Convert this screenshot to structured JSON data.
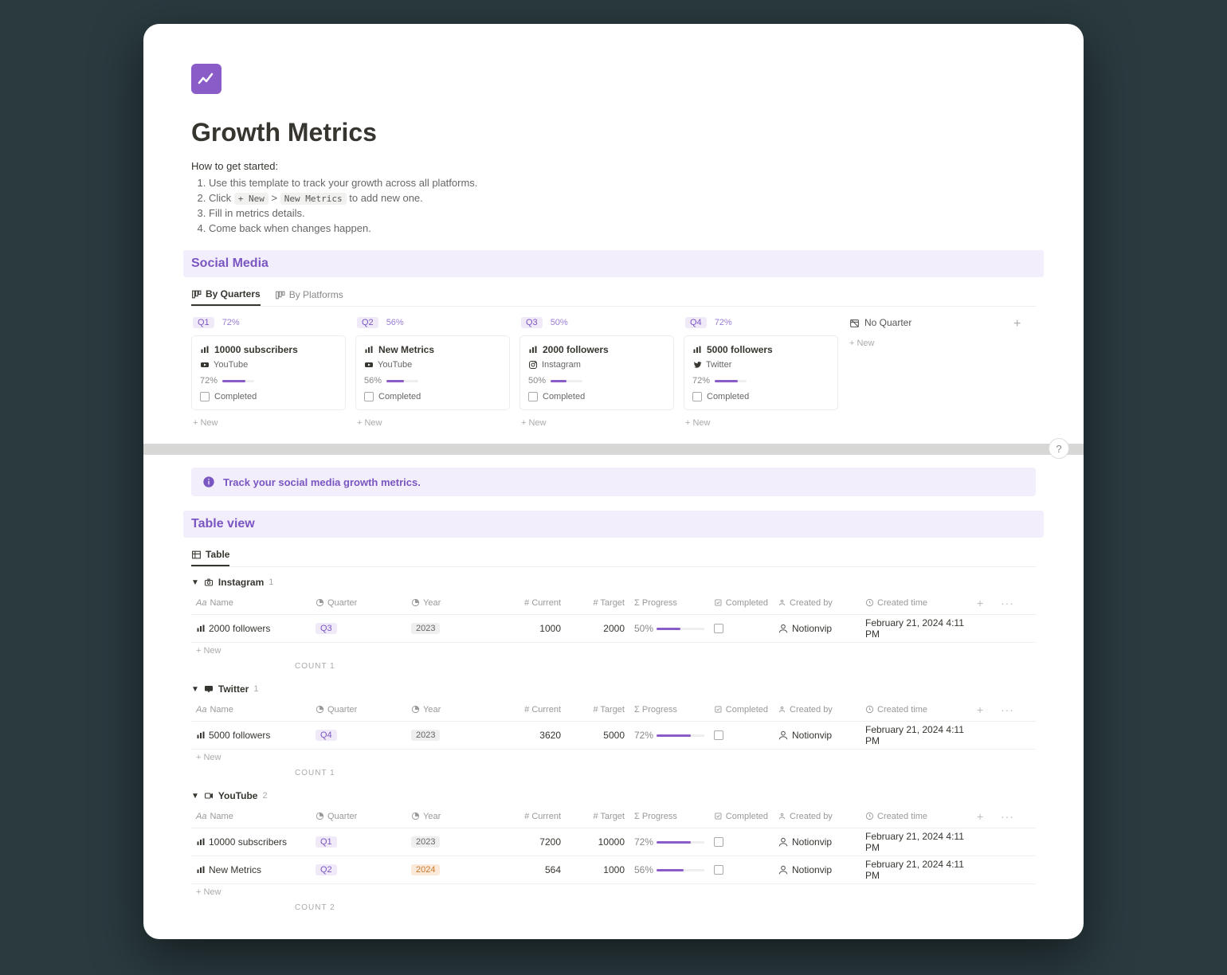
{
  "page": {
    "title": "Growth Metrics",
    "intro": "How to get started:",
    "steps": {
      "s1": "Use this template to track your growth across all platforms.",
      "s2_pre": "Click",
      "s2_chip1": "+ New",
      "s2_sep": ">",
      "s2_chip2": "New Metrics",
      "s2_post": "to add new one.",
      "s3": "Fill in metrics details.",
      "s4": "Come back when changes happen."
    }
  },
  "social": {
    "heading": "Social Media",
    "tabs": {
      "t1": "By Quarters",
      "t2": "By Platforms"
    },
    "cols": [
      {
        "q": "Q1",
        "pct": "72%",
        "card": {
          "title": "10000 subscribers",
          "platform": "YouTube",
          "prog": 72,
          "progLabel": "72%",
          "chk": "Completed"
        }
      },
      {
        "q": "Q2",
        "pct": "56%",
        "card": {
          "title": "New Metrics",
          "platform": "YouTube",
          "prog": 56,
          "progLabel": "56%",
          "chk": "Completed"
        }
      },
      {
        "q": "Q3",
        "pct": "50%",
        "card": {
          "title": "2000 followers",
          "platform": "Instagram",
          "prog": 50,
          "progLabel": "50%",
          "chk": "Completed"
        }
      },
      {
        "q": "Q4",
        "pct": "72%",
        "card": {
          "title": "5000 followers",
          "platform": "Twitter",
          "prog": 72,
          "progLabel": "72%",
          "chk": "Completed"
        }
      }
    ],
    "noQuarter": "No Quarter",
    "newLabel": "+  New",
    "plus": "+"
  },
  "callout": "Track your social media growth metrics.",
  "tableview": {
    "heading": "Table view",
    "tab": "Table",
    "cols": {
      "name": "Name",
      "quarter": "Quarter",
      "year": "Year",
      "current": "Current",
      "target": "Target",
      "progress": "Progress",
      "completed": "Completed",
      "createdBy": "Created by",
      "createdTime": "Created time"
    },
    "newRow": "+ New",
    "countLabel": "COUNT",
    "groups": [
      {
        "name": "Instagram",
        "count": "1",
        "rows": [
          {
            "name": "2000 followers",
            "quarter": "Q3",
            "year": "2023",
            "current": "1000",
            "target": "2000",
            "prog": 50,
            "progLabel": "50%",
            "by": "Notionvip",
            "time": "February 21, 2024 4:11 PM"
          }
        ],
        "footCount": "1"
      },
      {
        "name": "Twitter",
        "count": "1",
        "rows": [
          {
            "name": "5000 followers",
            "quarter": "Q4",
            "year": "2023",
            "current": "3620",
            "target": "5000",
            "prog": 72,
            "progLabel": "72%",
            "by": "Notionvip",
            "time": "February 21, 2024 4:11 PM"
          }
        ],
        "footCount": "1"
      },
      {
        "name": "YouTube",
        "count": "2",
        "rows": [
          {
            "name": "10000 subscribers",
            "quarter": "Q1",
            "year": "2023",
            "current": "7200",
            "target": "10000",
            "prog": 72,
            "progLabel": "72%",
            "by": "Notionvip",
            "time": "February 21, 2024 4:11 PM"
          },
          {
            "name": "New Metrics",
            "quarter": "Q2",
            "year": "2024",
            "yearClass": "orange",
            "current": "564",
            "target": "1000",
            "prog": 56,
            "progLabel": "56%",
            "by": "Notionvip",
            "time": "February 21, 2024 4:11 PM"
          }
        ],
        "footCount": "2"
      }
    ]
  },
  "help": "?"
}
